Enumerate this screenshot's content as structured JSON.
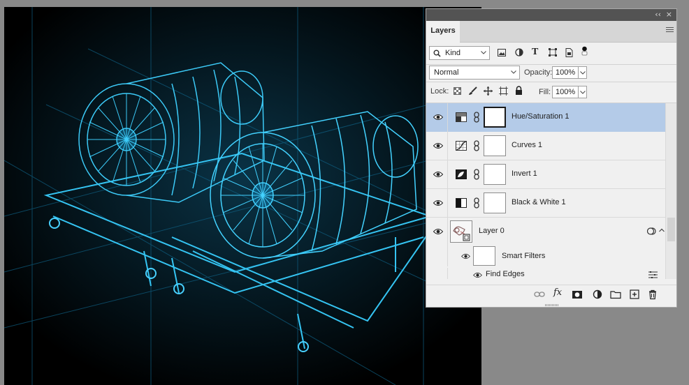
{
  "panel": {
    "title": "Layers",
    "collapse_glyph": "‹‹",
    "close_glyph": "×"
  },
  "filter": {
    "kind_label": "Kind",
    "icons": [
      "pixel-filter-icon",
      "adjustment-filter-icon",
      "type-filter-icon",
      "shape-filter-icon",
      "smart-object-filter-icon"
    ]
  },
  "blend": {
    "mode": "Normal",
    "opacity_label": "Opacity:",
    "opacity_value": "100%",
    "lock_label": "Lock:",
    "fill_label": "Fill:",
    "fill_value": "100%"
  },
  "layers": [
    {
      "name": "Hue/Saturation 1",
      "type": "hue-saturation",
      "selected": true
    },
    {
      "name": "Curves 1",
      "type": "curves",
      "selected": false
    },
    {
      "name": "Invert 1",
      "type": "invert",
      "selected": false
    },
    {
      "name": "Black & White 1",
      "type": "black-white",
      "selected": false
    },
    {
      "name": "Layer 0",
      "type": "smart-object",
      "selected": false
    }
  ],
  "smart_filters": {
    "label": "Smart Filters",
    "filter_name": "Find Edges"
  },
  "colors": {
    "selection": "#b4cbe8",
    "canvas_line": "#2fb7ea",
    "panel_bg": "#f0f0f0"
  }
}
